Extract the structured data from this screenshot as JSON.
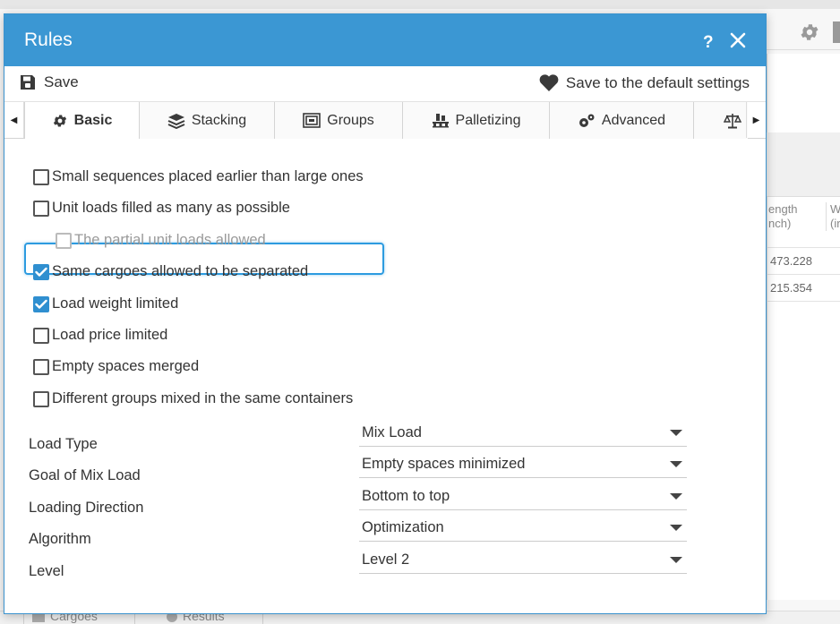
{
  "dialog": {
    "title": "Rules",
    "help_label": "?",
    "save_label": "Save",
    "default_label": "Save to the default settings"
  },
  "tabs": [
    {
      "label": "Basic",
      "icon": "gear-icon",
      "active": true
    },
    {
      "label": "Stacking",
      "icon": "layers-icon"
    },
    {
      "label": "Groups",
      "icon": "groups-icon"
    },
    {
      "label": "Palletizing",
      "icon": "pallet-icon"
    },
    {
      "label": "Advanced",
      "icon": "gears-icon"
    },
    {
      "label": "",
      "icon": "scale-icon"
    }
  ],
  "options": [
    {
      "label": "Small sequences placed earlier than large ones",
      "checked": false
    },
    {
      "label": "Unit loads filled as many as possible",
      "checked": false
    },
    {
      "label": "The partial unit loads allowed",
      "checked": false,
      "disabled": true
    },
    {
      "label": "Same cargoes allowed to be separated",
      "checked": true
    },
    {
      "label": "Load weight limited",
      "checked": true
    },
    {
      "label": "Load price limited",
      "checked": false
    },
    {
      "label": "Empty spaces merged",
      "checked": false
    },
    {
      "label": "Different groups mixed in the same containers",
      "checked": false
    }
  ],
  "fields": [
    {
      "label": "Load Type",
      "value": "Mix Load"
    },
    {
      "label": "Goal of Mix Load",
      "value": "Empty spaces minimized"
    },
    {
      "label": "Loading Direction",
      "value": "Bottom to top"
    },
    {
      "label": "Algorithm",
      "value": "Optimization"
    },
    {
      "label": "Level",
      "value": "Level 2"
    }
  ],
  "background": {
    "col1_header_line1": "ength",
    "col1_header_line2": "nch)",
    "col2_header_line1": "W",
    "col2_header_line2": "(ir",
    "row1_value": "473.228",
    "row2_value": "215.354",
    "bottom_tab1": "Cargoes",
    "bottom_tab2": "Results"
  },
  "colors": {
    "titlebar": "#3b97d3",
    "checked": "#2f8fd0",
    "focus": "#2d9be0"
  }
}
